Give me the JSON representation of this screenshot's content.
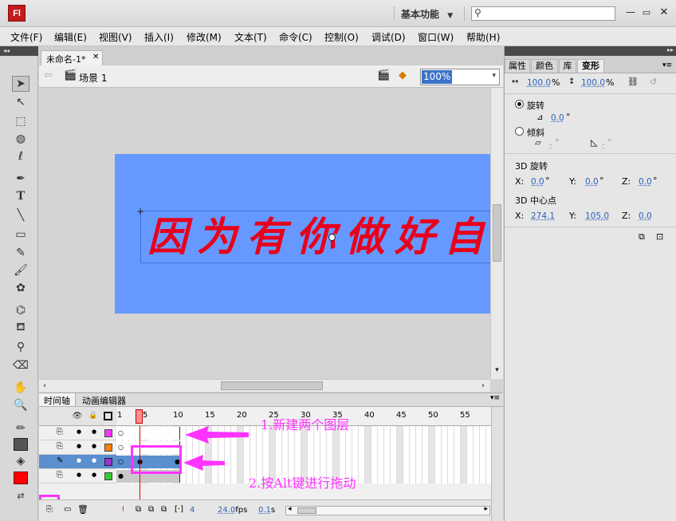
{
  "app": {
    "logo": "Fl",
    "workspace": "基本功能",
    "search_placeholder": ""
  },
  "menu": [
    "文件(F)",
    "编辑(E)",
    "视图(V)",
    "插入(I)",
    "修改(M)",
    "文本(T)",
    "命令(C)",
    "控制(O)",
    "调试(D)",
    "窗口(W)",
    "帮助(H)"
  ],
  "document": {
    "tab": "未命名-1*",
    "scene": "场景 1",
    "zoom": "100%"
  },
  "stage": {
    "text": "因为有你做好自己",
    "bg_color": "#6699ff",
    "text_color": "#e8001c"
  },
  "timeline": {
    "tabs": [
      "时间轴",
      "动画编辑器"
    ],
    "frame_numbers": [
      "1",
      "5",
      "10",
      "15",
      "20",
      "25",
      "30",
      "35",
      "40",
      "45",
      "50",
      "55"
    ],
    "layer_colors": [
      "#ff33ff",
      "#ff7f00",
      "#9933cc",
      "#33cc33"
    ],
    "status": {
      "frame": "4",
      "fps": "24.0",
      "fps_unit": "fps",
      "time": "0.1",
      "time_unit": "s"
    },
    "playhead_frame": 4
  },
  "annotations": {
    "note1": "1.新建两个图层",
    "note2": "2.按Alt键进行拖动",
    "color": "#ff33ff"
  },
  "panel": {
    "tabs": [
      "属性",
      "颜色",
      "库",
      "变形"
    ],
    "scale_w": "100.0",
    "scale_h": "100.0",
    "percent": "%",
    "rotate_label": "旋转",
    "rotate_value": "0.0",
    "deg": "°",
    "skew_label": "倾斜",
    "skew_h": "-",
    "skew_v": "-",
    "rot3d_title": "3D 旋转",
    "rot3d": {
      "x": "0.0",
      "y": "0.0",
      "z": "0.0"
    },
    "center_title": "3D 中心点",
    "center": {
      "x": "274.1",
      "y": "105.0",
      "z": "0.0"
    },
    "x_label": "X:",
    "y_label": "Y:",
    "z_label": "Z:"
  }
}
